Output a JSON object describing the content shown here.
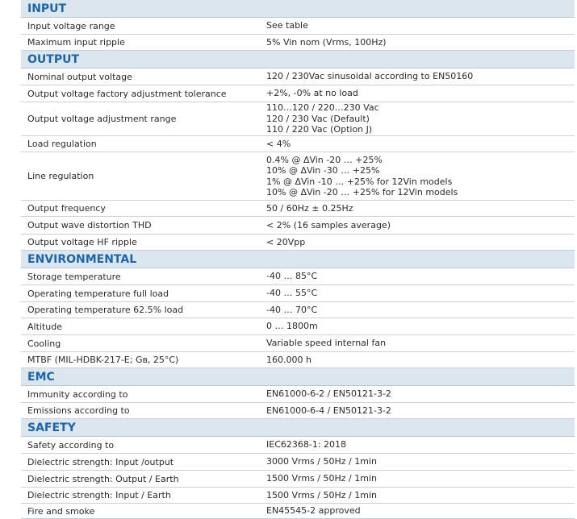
{
  "sections": [
    {
      "title": "INPUT",
      "rows": [
        {
          "label": "Input voltage range",
          "values": [
            "See table"
          ],
          "h": "h21"
        },
        {
          "label": "Maximum input ripple",
          "values": [
            "5% Vin nom (Vrms, 100Hz)"
          ],
          "h": "h20"
        }
      ]
    },
    {
      "title": "OUTPUT",
      "rows": [
        {
          "label": "Nominal output voltage",
          "values": [
            "120 / 230Vac sinusoidal according to EN50160"
          ],
          "h": "h21"
        },
        {
          "label": "Output voltage factory adjustment tolerance",
          "values": [
            "+2%, -0% at no load"
          ],
          "h": "h21"
        },
        {
          "label": "Output voltage adjustment range",
          "values": [
            "110…120 / 220…230 Vac",
            "120 / 230 Vac (Default)",
            "110 / 220 Vac (Option J)"
          ],
          "h": "h42"
        },
        {
          "label": "Load regulation",
          "values": [
            "< 4%"
          ],
          "h": "h20"
        },
        {
          "label": "Line regulation",
          "values": [
            "0.4% @ ΔVin -20 … +25%",
            "10% @ ΔVin -30 … +25%",
            "1% @ ΔVin -10 … +25% for 12Vin models",
            "10% @ ΔVin -20 … +25% for 12Vin models"
          ],
          "h": "h60"
        },
        {
          "label": "Output frequency",
          "values": [
            "50 / 60Hz ± 0.25Hz"
          ],
          "h": "h20"
        },
        {
          "label": "Output wave distortion THD",
          "values": [
            "< 2% (16 samples average)"
          ],
          "h": "h22"
        },
        {
          "label": "Output voltage HF ripple",
          "values": [
            "< 20Vpp"
          ],
          "h": "h20"
        }
      ]
    },
    {
      "title": "ENVIRONMENTAL",
      "rows": [
        {
          "label": "Storage temperature",
          "values": [
            "-40 … 85°C"
          ],
          "h": "h21"
        },
        {
          "label": "Operating temperature full load",
          "values": [
            "-40 … 55°C"
          ],
          "h": "h21"
        },
        {
          "label": "Operating temperature 62.5% load",
          "values": [
            "-40 … 70°C"
          ],
          "h": "h20"
        },
        {
          "label": "Altitude",
          "values": [
            "0 … 1800m"
          ],
          "h": "h21"
        },
        {
          "label": "Cooling",
          "values": [
            "Variable speed internal fan"
          ],
          "h": "h21"
        },
        {
          "label": "MTBF (MIL-HDBK-217-E; Gʙ, 25°C)",
          "values": [
            "160.000 h"
          ],
          "h": "h20"
        }
      ]
    },
    {
      "title": "EMC",
      "rows": [
        {
          "label": "Immunity according to",
          "values": [
            "EN61000-6-2 / EN50121-3-2"
          ],
          "h": "h21"
        },
        {
          "label": "Emissions according to",
          "values": [
            "EN61000-6-4 / EN50121-3-2"
          ],
          "h": "h20"
        }
      ]
    },
    {
      "title": "SAFETY",
      "rows": [
        {
          "label": "Safety according to",
          "values": [
            "IEC62368-1: 2018"
          ],
          "h": "h21"
        },
        {
          "label": "Dielectric strength:  Input /output",
          "values": [
            "3000 Vrms / 50Hz / 1min"
          ],
          "h": "h21"
        },
        {
          "label": "Dielectric strength: Output / Earth",
          "values": [
            "1500 Vrms / 50Hz / 1min"
          ],
          "h": "h21"
        },
        {
          "label": "Dielectric strength: Input / Earth",
          "values": [
            "1500 Vrms / 50Hz / 1min"
          ],
          "h": "h20"
        },
        {
          "label": "Fire and smoke",
          "values": [
            "EN45545-2 approved"
          ],
          "h": "h19"
        }
      ]
    }
  ]
}
